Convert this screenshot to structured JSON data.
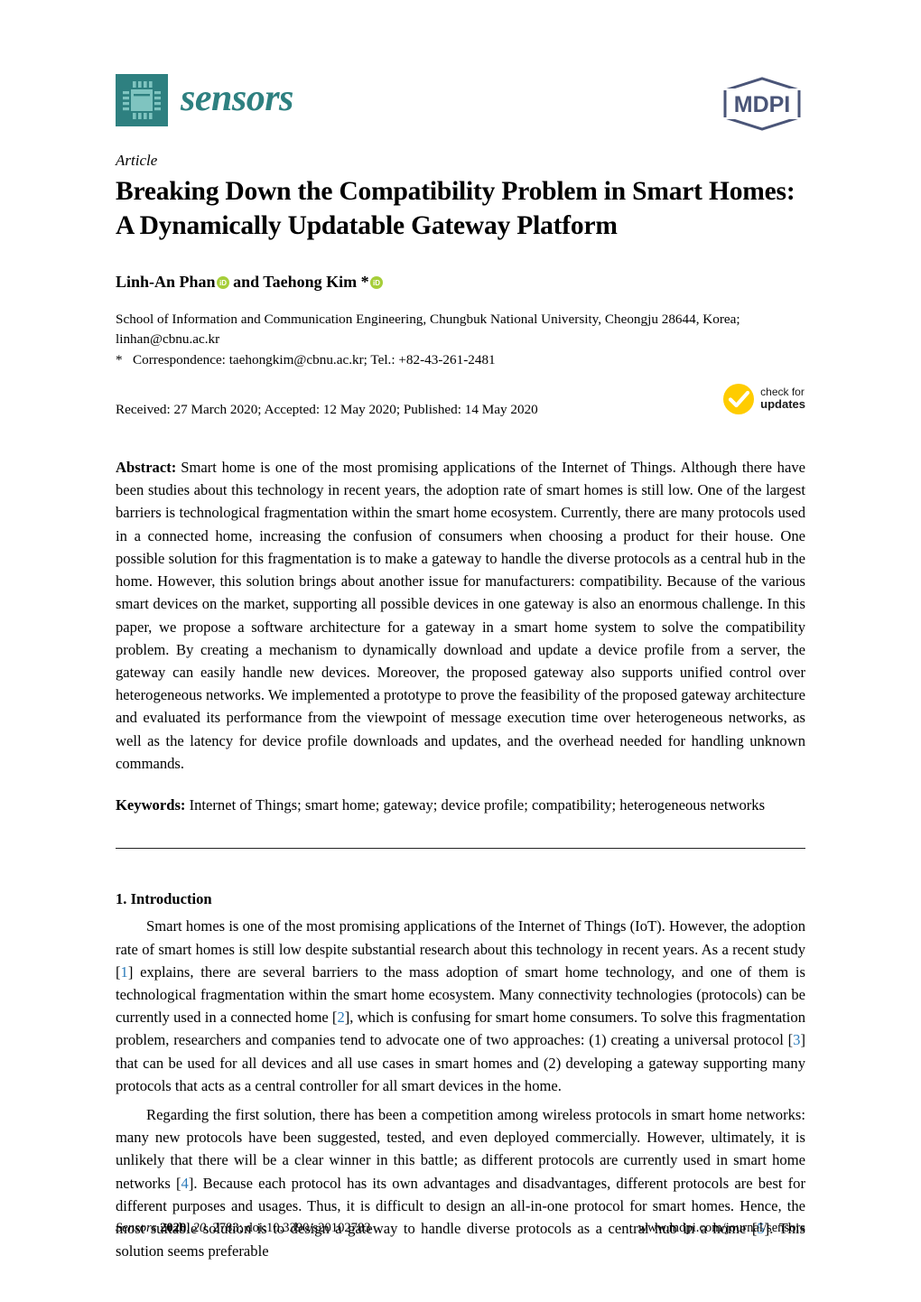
{
  "journal": {
    "name": "sensors",
    "logo_icon": "microchip-icon",
    "publisher_logo_text": "MDPI",
    "brand_color": "#2e8080"
  },
  "article": {
    "type": "Article",
    "title": "Breaking Down the Compatibility Problem in Smart Homes: A Dynamically Updatable Gateway Platform",
    "authors_prefix": "Linh-An Phan",
    "authors_conjunction": " and ",
    "authors_second": "Taehong Kim *",
    "orcid_icon_label": "iD",
    "orcid_color": "#a6ce39"
  },
  "affiliations": {
    "line1": "School of Information and Communication Engineering, Chungbuk National University, Cheongju 28644, Korea;",
    "line2": "linhan@cbnu.ac.kr",
    "correspondence_marker": "*",
    "correspondence": "Correspondence: taehongkim@cbnu.ac.kr; Tel.: +82-43-261-2481"
  },
  "dates": {
    "text": "Received: 27 March 2020; Accepted: 12 May 2020; Published: 14 May 2020"
  },
  "crossmark": {
    "line1": "check for",
    "line2": "updates",
    "icon": "check-circle-icon",
    "color": "#ffcc00"
  },
  "abstract": {
    "label": "Abstract:",
    "text": "Smart home is one of the most promising applications of the Internet of Things. Although there have been studies about this technology in recent years, the adoption rate of smart homes is still low. One of the largest barriers is technological fragmentation within the smart home ecosystem. Currently, there are many protocols used in a connected home, increasing the confusion of consumers when choosing a product for their house. One possible solution for this fragmentation is to make a gateway to handle the diverse protocols as a central hub in the home. However, this solution brings about another issue for manufacturers: compatibility. Because of the various smart devices on the market, supporting all possible devices in one gateway is also an enormous challenge. In this paper, we propose a software architecture for a gateway in a smart home system to solve the compatibility problem. By creating a mechanism to dynamically download and update a device profile from a server, the gateway can easily handle new devices. Moreover, the proposed gateway also supports unified control over heterogeneous networks. We implemented a prototype to prove the feasibility of the proposed gateway architecture and evaluated its performance from the viewpoint of message execution time over heterogeneous networks, as well as the latency for device profile downloads and updates, and the overhead needed for handling unknown commands."
  },
  "keywords": {
    "label": "Keywords:",
    "text": "Internet of Things; smart home; gateway; device profile; compatibility; heterogeneous networks"
  },
  "sections": [
    {
      "heading": "1. Introduction",
      "paragraphs": [
        {
          "parts": [
            {
              "t": "Smart homes is one of the most promising applications of the Internet of Things (IoT). However, the adoption rate of smart homes is still low despite substantial research about this technology in recent years. As a recent study ["
            },
            {
              "t": "1",
              "cite": true
            },
            {
              "t": "] explains, there are several barriers to the mass adoption of smart home technology, and one of them is technological fragmentation within the smart home ecosystem. Many connectivity technologies (protocols) can be currently used in a connected home ["
            },
            {
              "t": "2",
              "cite": true
            },
            {
              "t": "], which is confusing for smart home consumers. To solve this fragmentation problem, researchers and companies tend to advocate one of two approaches: (1) creating a universal protocol ["
            },
            {
              "t": "3",
              "cite": true
            },
            {
              "t": "] that can be used for all devices and all use cases in smart homes and (2) developing a gateway supporting many protocols that acts as a central controller for all smart devices in the home."
            }
          ]
        },
        {
          "parts": [
            {
              "t": "Regarding the first solution, there has been a competition among wireless protocols in smart home networks: many new protocols have been suggested, tested, and even deployed commercially. However, ultimately, it is unlikely that there will be a clear winner in this battle; as different protocols are currently used in smart home networks ["
            },
            {
              "t": "4",
              "cite": true
            },
            {
              "t": "]. Because each protocol has its own advantages and disadvantages, different protocols are best for different purposes and usages. Thus, it is difficult to design an all-in-one protocol for smart homes. Hence, the most suitable solution is to design a gateway to handle diverse protocols as a central hub in a home ["
            },
            {
              "t": "5",
              "cite": true
            },
            {
              "t": "]. This solution seems preferable"
            }
          ]
        }
      ]
    }
  ],
  "footer": {
    "journal_italic": "Sensors",
    "year": "2020",
    "volume": ", 20",
    "rest": ", 2783; doi:10.3390/s20102783",
    "url": "www.mdpi.com/journal/sensors"
  }
}
